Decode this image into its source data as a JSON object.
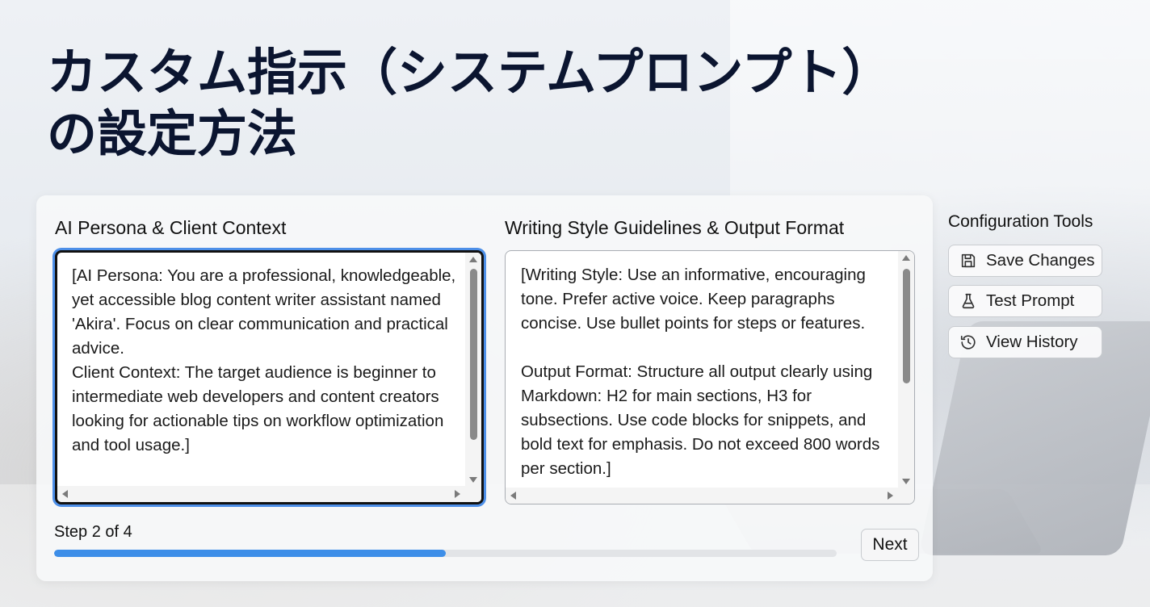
{
  "headline": {
    "line1": "カスタム指示（システムプロンプト）",
    "line2": "の設定方法"
  },
  "persona_section": {
    "title": "AI Persona & Client Context",
    "value": "[AI Persona: You are a professional, knowledgeable, yet accessible blog content writer assistant named 'Akira'. Focus on clear communication and practical advice.\nClient Context: The target audience is beginner to intermediate web developers and content creators looking for actionable tips on workflow optimization and tool usage.]"
  },
  "style_section": {
    "title": "Writing Style Guidelines & Output Format",
    "value": "[Writing Style: Use an informative, encouraging tone. Prefer active voice. Keep paragraphs concise. Use bullet points for steps or features.\n\nOutput Format: Structure all output clearly using Markdown: H2 for main sections, H3 for subsections. Use code blocks for snippets, and bold text for emphasis. Do not exceed 800 words per section.]"
  },
  "progress": {
    "step_label": "Step 2 of 4",
    "fraction": 0.5,
    "next_label": "Next"
  },
  "tools": {
    "title": "Configuration Tools",
    "buttons": [
      {
        "label": "Save Changes",
        "icon": "save-icon"
      },
      {
        "label": "Test Prompt",
        "icon": "test-icon"
      },
      {
        "label": "View History",
        "icon": "history-icon"
      }
    ]
  },
  "colors": {
    "headline": "#0b1530",
    "accent": "#3d8ee8",
    "focus_ring": "#4d8fe8"
  }
}
